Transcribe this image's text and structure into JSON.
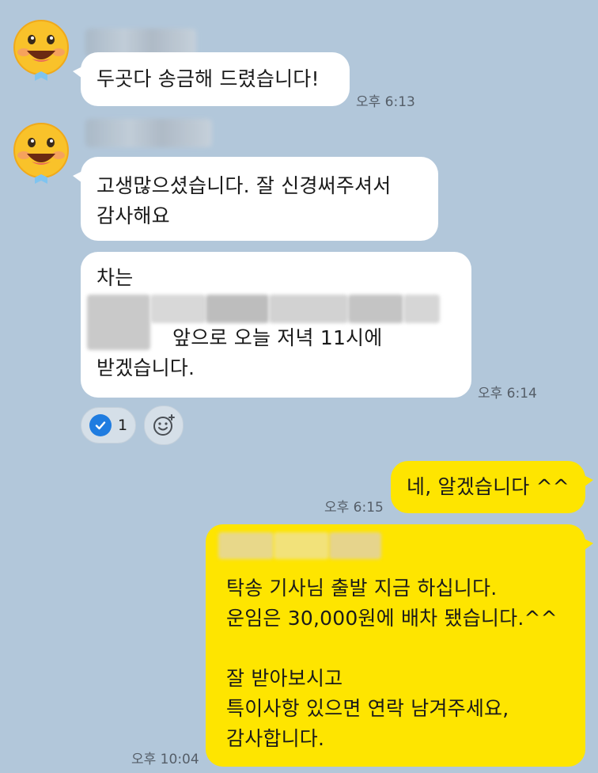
{
  "messages": [
    {
      "lines": [
        "두곳다 송금해 드렸습니다!"
      ],
      "time": "오후 6:13"
    },
    {
      "lines": [
        "고생많으셨습니다. 잘 신경써주셔서",
        "감사해요"
      ]
    },
    {
      "lines": [
        "차는",
        "앞으로 오늘 저녁 11시에",
        "받겠습니다."
      ],
      "time": "오후 6:14"
    },
    {
      "lines": [
        "네, 알겠습니다 ^^"
      ],
      "time": "오후 6:15"
    },
    {
      "lines": [
        "탁송 기사님 출발 지금 하십니다.",
        "운임은 30,000원에 배차 됐습니다.^^",
        "",
        "잘 받아보시고",
        "특이사항 있으면 연락 남겨주세요,",
        "감사합니다."
      ],
      "time": "오후 10:04"
    }
  ],
  "reaction": {
    "count": "1",
    "icon": "check-icon",
    "add_icon": "add-emoji-icon"
  },
  "colors": {
    "background": "#b2c7da",
    "mine_bubble": "#fee500",
    "other_bubble": "#ffffff",
    "check": "#1f7ce0"
  }
}
